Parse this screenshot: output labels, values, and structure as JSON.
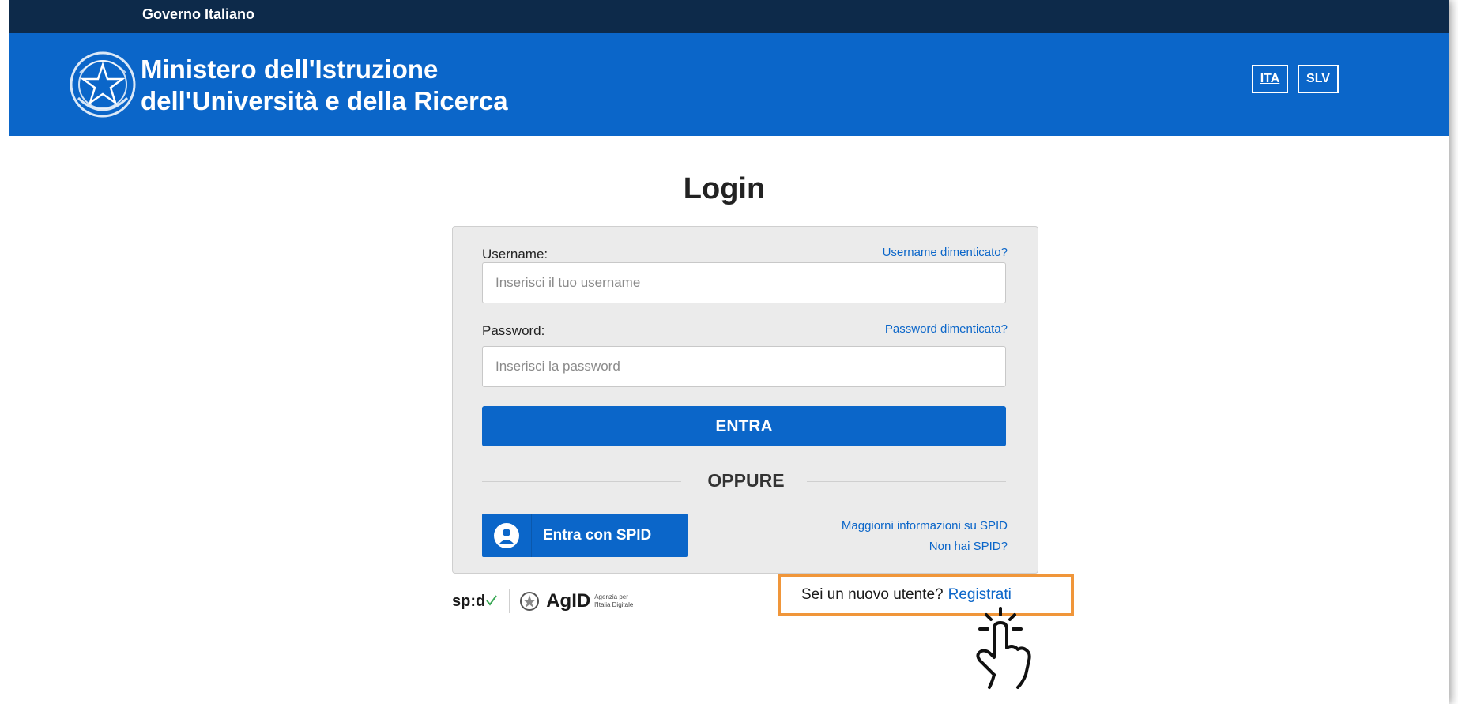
{
  "gov_bar": {
    "label": "Governo Italiano"
  },
  "header": {
    "title_line1": "Ministero dell'Istruzione",
    "title_line2": "dell'Università e della Ricerca",
    "emblem_icon": "repubblica-emblem-icon",
    "languages": [
      {
        "code": "ITA",
        "active": true
      },
      {
        "code": "SLV",
        "active": false
      }
    ]
  },
  "login": {
    "title": "Login",
    "username_label": "Username:",
    "username_forgot": "Username dimenticato?",
    "username_placeholder": "Inserisci il tuo username",
    "password_label": "Password:",
    "password_forgot": "Password dimenticata?",
    "password_placeholder": "Inserisci la password",
    "submit_label": "ENTRA",
    "separator": "OPPURE",
    "spid_button": "Entra con SPID",
    "spid_more_info": "Maggiorni informazioni su SPID",
    "spid_no": "Non hai SPID?"
  },
  "footer": {
    "spid_logo": "sp:d",
    "agid_logo": "AgID",
    "agid_sub_line1": "Agenzia per",
    "agid_sub_line2": "l'Italia Digitale"
  },
  "register": {
    "question": "Sei un nuovo utente?",
    "link": "Registrati"
  },
  "colors": {
    "primary": "#0b66c9",
    "gov_bar": "#0d2a4a",
    "highlight": "#f0963a"
  }
}
